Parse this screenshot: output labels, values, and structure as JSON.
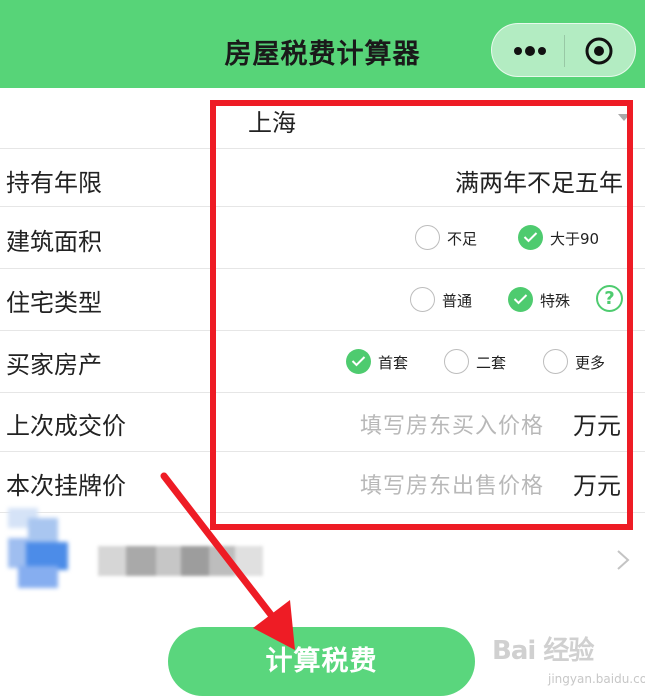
{
  "header": {
    "title": "房屋税费计算器"
  },
  "city": {
    "value": "上海"
  },
  "rows": {
    "holding": {
      "label": "持有年限",
      "value": "满两年不足五年"
    },
    "area": {
      "label": "建筑面积",
      "options": [
        "不足",
        "大于90"
      ],
      "selected": "大于90"
    },
    "house_type": {
      "label": "住宅类型",
      "options": [
        "普通",
        "特殊"
      ],
      "selected": "特殊",
      "help": "?"
    },
    "buyer": {
      "label": "买家房产",
      "options": [
        "首套",
        "二套",
        "更多"
      ],
      "selected": "首套"
    },
    "last_price": {
      "label": "上次成交价",
      "placeholder": "填写房东买入价格",
      "unit": "万元"
    },
    "list_price": {
      "label": "本次挂牌价",
      "placeholder": "填写房东出售价格",
      "unit": "万元"
    }
  },
  "button": {
    "label": "计算税费"
  },
  "watermark": {
    "logo": "Bai 经验",
    "url": "jingyan.baidu.com"
  },
  "colors": {
    "header": "#57d478",
    "accent": "#4ecb6f",
    "highlight": "#ee1c25"
  }
}
